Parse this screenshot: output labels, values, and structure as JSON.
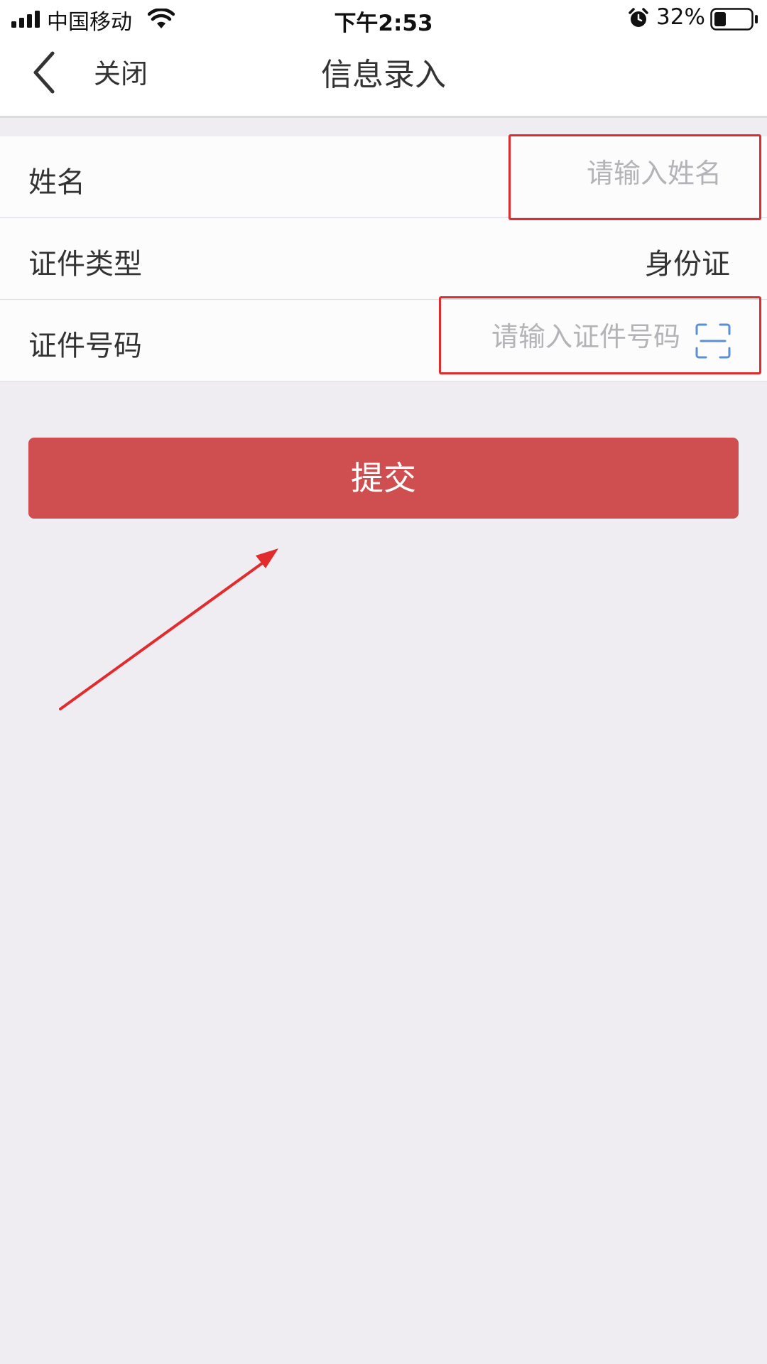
{
  "status_bar": {
    "carrier": "中国移动",
    "time": "下午2:53",
    "battery_percent": "32%",
    "battery_level": 0.32
  },
  "nav": {
    "close_label": "关闭",
    "title": "信息录入"
  },
  "form": {
    "name": {
      "label": "姓名",
      "placeholder": "请输入姓名"
    },
    "id_type": {
      "label": "证件类型",
      "value": "身份证"
    },
    "id_number": {
      "label": "证件号码",
      "placeholder": "请输入证件号码"
    }
  },
  "submit_label": "提交",
  "colors": {
    "accent": "#cf4f51",
    "annotation": "#e02c2c",
    "scan_icon": "#5b8fd6",
    "background": "#efedf2"
  }
}
